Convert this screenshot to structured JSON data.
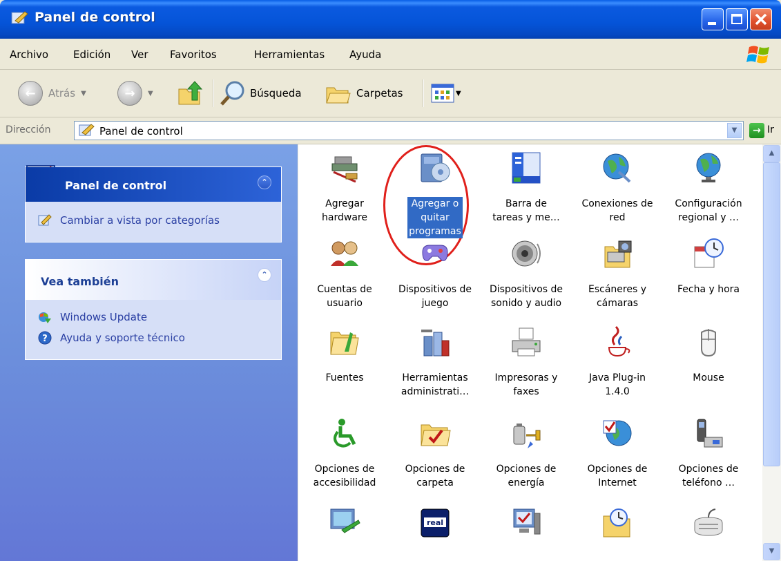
{
  "window": {
    "title": "Panel de control"
  },
  "menu": [
    "Archivo",
    "Edición",
    "Ver",
    "Favoritos",
    "Herramientas",
    "Ayuda"
  ],
  "toolbar": {
    "back_label": "Atrás",
    "search_label": "Búsqueda",
    "folders_label": "Carpetas"
  },
  "address": {
    "label": "Dirección",
    "value": "Panel de control",
    "go_label": "Ir"
  },
  "left_pane": {
    "panel1": {
      "title": "Panel de control",
      "task": "Cambiar a vista por categorías"
    },
    "panel2": {
      "title": "Vea también",
      "links": [
        "Windows Update",
        "Ayuda y soporte técnico"
      ]
    }
  },
  "items": [
    {
      "label": "Agregar\nhardware",
      "icon": "hardware-icon"
    },
    {
      "label": "Agregar o\nquitar\nprogramas",
      "icon": "add-remove-programs-icon",
      "selected": true
    },
    {
      "label": "Barra de\ntareas y me…",
      "icon": "taskbar-icon"
    },
    {
      "label": "Conexiones de\nred",
      "icon": "network-icon"
    },
    {
      "label": "Configuración\nregional y …",
      "icon": "globe-icon"
    },
    {
      "label": "Cuentas de\nusuario",
      "icon": "users-icon"
    },
    {
      "label": "Dispositivos de\njuego",
      "icon": "gamepad-icon"
    },
    {
      "label": "Dispositivos de\nsonido y audio",
      "icon": "speaker-icon"
    },
    {
      "label": "Escáneres y\ncámaras",
      "icon": "scanner-icon"
    },
    {
      "label": "Fecha y hora",
      "icon": "calendar-clock-icon"
    },
    {
      "label": "Fuentes",
      "icon": "fonts-folder-icon"
    },
    {
      "label": "Herramientas\nadministrati…",
      "icon": "admin-tools-icon"
    },
    {
      "label": "Impresoras y\nfaxes",
      "icon": "printer-icon"
    },
    {
      "label": "Java Plug-in\n1.4.0",
      "icon": "java-icon"
    },
    {
      "label": "Mouse",
      "icon": "mouse-icon"
    },
    {
      "label": "Opciones de\naccesibilidad",
      "icon": "accessibility-icon"
    },
    {
      "label": "Opciones de\ncarpeta",
      "icon": "folder-options-icon"
    },
    {
      "label": "Opciones de\nenergía",
      "icon": "power-icon"
    },
    {
      "label": "Opciones de\nInternet",
      "icon": "internet-globe-icon"
    },
    {
      "label": "Opciones de\nteléfono …",
      "icon": "phone-icon"
    },
    {
      "label": "",
      "icon": "display-icon"
    },
    {
      "label": "",
      "icon": "realplayer-icon",
      "caption": "real"
    },
    {
      "label": "",
      "icon": "system-icon"
    },
    {
      "label": "",
      "icon": "scheduled-tasks-icon"
    },
    {
      "label": "",
      "icon": "keyboard-icon"
    }
  ],
  "colors": {
    "selection": "#316ac5",
    "highlight_ring": "#e0201b",
    "title_blue": "#0554d8"
  }
}
